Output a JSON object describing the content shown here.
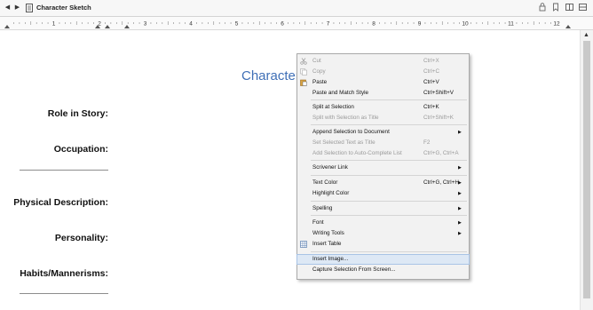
{
  "header": {
    "doc_title": "Character Sketch",
    "back_icon": "back-arrow-icon",
    "forward_icon": "forward-arrow-icon"
  },
  "ruler": {
    "numbers": [
      "1",
      "2",
      "3",
      "4",
      "5",
      "6",
      "7",
      "8",
      "9",
      "10",
      "11",
      "12"
    ]
  },
  "document": {
    "title": "Character",
    "fields": [
      "Role in Story:",
      "Occupation:",
      "Physical Description:",
      "Personality:",
      "Habits/Mannerisms:"
    ]
  },
  "context_menu": {
    "items": [
      {
        "label": "Cut",
        "shortcut": "Ctrl+X",
        "disabled": true,
        "icon": "scissors-icon"
      },
      {
        "label": "Copy",
        "shortcut": "Ctrl+C",
        "disabled": true,
        "icon": "copy-icon"
      },
      {
        "label": "Paste",
        "shortcut": "Ctrl+V",
        "disabled": false,
        "icon": "clipboard-icon"
      },
      {
        "label": "Paste and Match Style",
        "shortcut": "Ctrl+Shift+V",
        "disabled": false
      },
      {
        "label": "Split at Selection",
        "shortcut": "Ctrl+K",
        "disabled": false
      },
      {
        "label": "Split with Selection as Title",
        "shortcut": "Ctrl+Shift+K",
        "disabled": true
      },
      {
        "label": "Append Selection to Document",
        "shortcut": "",
        "disabled": false,
        "submenu": true
      },
      {
        "label": "Set Selected Text as Title",
        "shortcut": "F2",
        "disabled": true
      },
      {
        "label": "Add Selection to Auto-Complete List",
        "shortcut": "Ctrl+G, Ctrl+A",
        "disabled": true
      },
      {
        "label": "Scrivener Link",
        "shortcut": "",
        "disabled": false,
        "submenu": true
      },
      {
        "label": "Text Color",
        "shortcut": "Ctrl+G, Ctrl+H",
        "disabled": false,
        "submenu": true
      },
      {
        "label": "Highlight Color",
        "shortcut": "",
        "disabled": false,
        "submenu": true
      },
      {
        "label": "Spelling",
        "shortcut": "",
        "disabled": false,
        "submenu": true
      },
      {
        "label": "Font",
        "shortcut": "",
        "disabled": false,
        "submenu": true
      },
      {
        "label": "Writing Tools",
        "shortcut": "",
        "disabled": false,
        "submenu": true
      },
      {
        "label": "Insert Table",
        "shortcut": "",
        "disabled": false,
        "icon": "table-icon"
      },
      {
        "label": "Insert Image...",
        "shortcut": "",
        "disabled": false,
        "highlighted": true
      },
      {
        "label": "Capture Selection From Screen...",
        "shortcut": "",
        "disabled": false
      }
    ]
  },
  "colors": {
    "title": "#3f6fb6",
    "menu_highlight": "#dde8f5"
  }
}
